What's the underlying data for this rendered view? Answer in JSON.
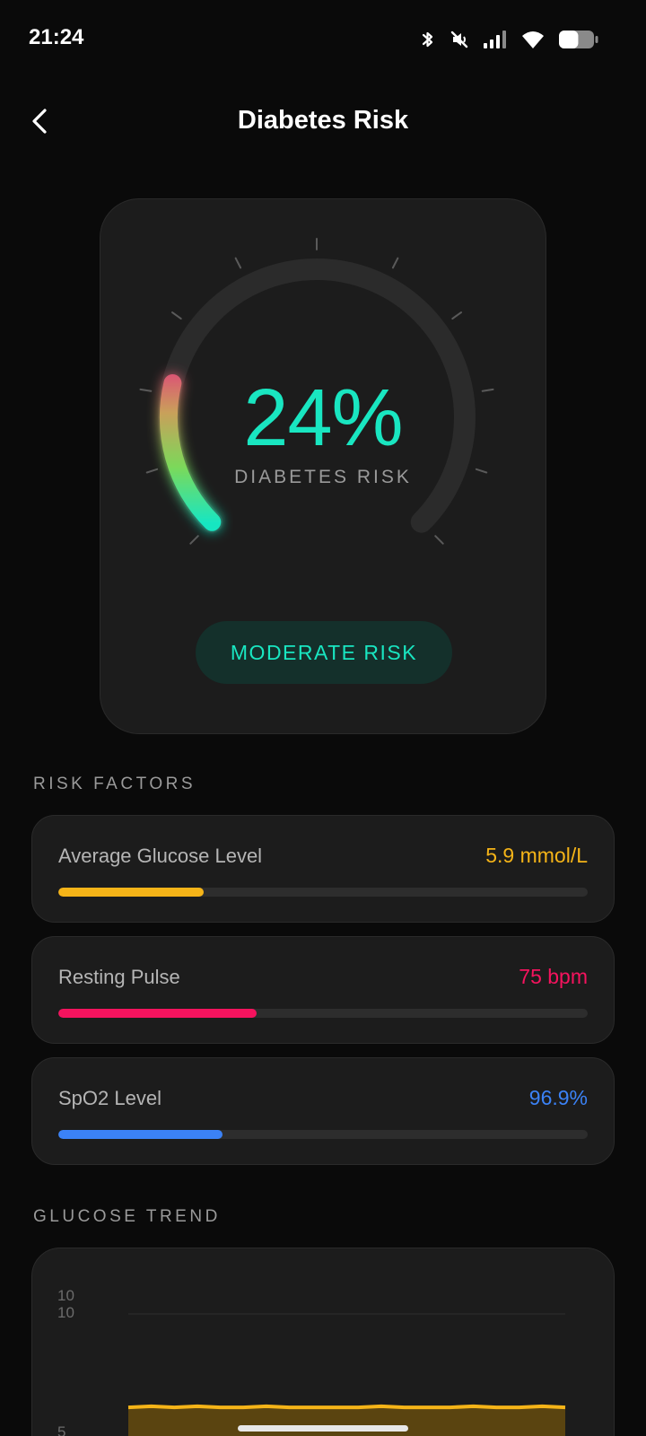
{
  "status_bar": {
    "time": "21:24",
    "icons": [
      "bluetooth-icon",
      "mute-icon",
      "signal-icon",
      "wifi-icon",
      "battery-icon"
    ],
    "battery_level": 0.55
  },
  "header": {
    "title": "Diabetes Risk",
    "back_icon": "chevron-left-icon"
  },
  "gauge": {
    "value_text": "24%",
    "value": 24,
    "label": "DIABETES RISK",
    "badge": "MODERATE RISK",
    "colors": {
      "accent": "#19e6c1",
      "arc_gradient": [
        "#19e6c1",
        "#7bd95a",
        "#c9a05a",
        "#e0447a"
      ],
      "track": "#2b2b2b"
    }
  },
  "risk_factors": {
    "heading": "RISK FACTORS",
    "items": [
      {
        "label": "Average Glucose Level",
        "value": "5.9 mmol/L",
        "color": "#f5b418",
        "level": 0.275
      },
      {
        "label": "Resting Pulse",
        "value": "75 bpm",
        "color": "#f5135e",
        "level": 0.375
      },
      {
        "label": "SpO2 Level",
        "value": "96.9%",
        "color": "#3b82f6",
        "level": 0.31
      }
    ]
  },
  "glucose_trend": {
    "heading": "GLUCOSE TREND",
    "y_ticks": [
      "10",
      "10",
      "5"
    ],
    "line_color": "#f5b418",
    "fill_color": "#5a4410"
  },
  "chart_data": {
    "type": "area",
    "title": "",
    "xlabel": "",
    "ylabel": "",
    "ylim": [
      5,
      10
    ],
    "y_ticks": [
      10,
      5
    ],
    "grid": true,
    "series": [
      {
        "values": [
          5.9,
          5.95,
          5.9,
          5.95,
          5.9,
          5.9,
          5.95,
          5.9,
          5.9,
          5.9,
          5.9,
          5.95,
          5.9,
          5.9,
          5.9,
          5.95,
          5.9,
          5.9,
          5.95,
          5.9
        ]
      }
    ]
  }
}
